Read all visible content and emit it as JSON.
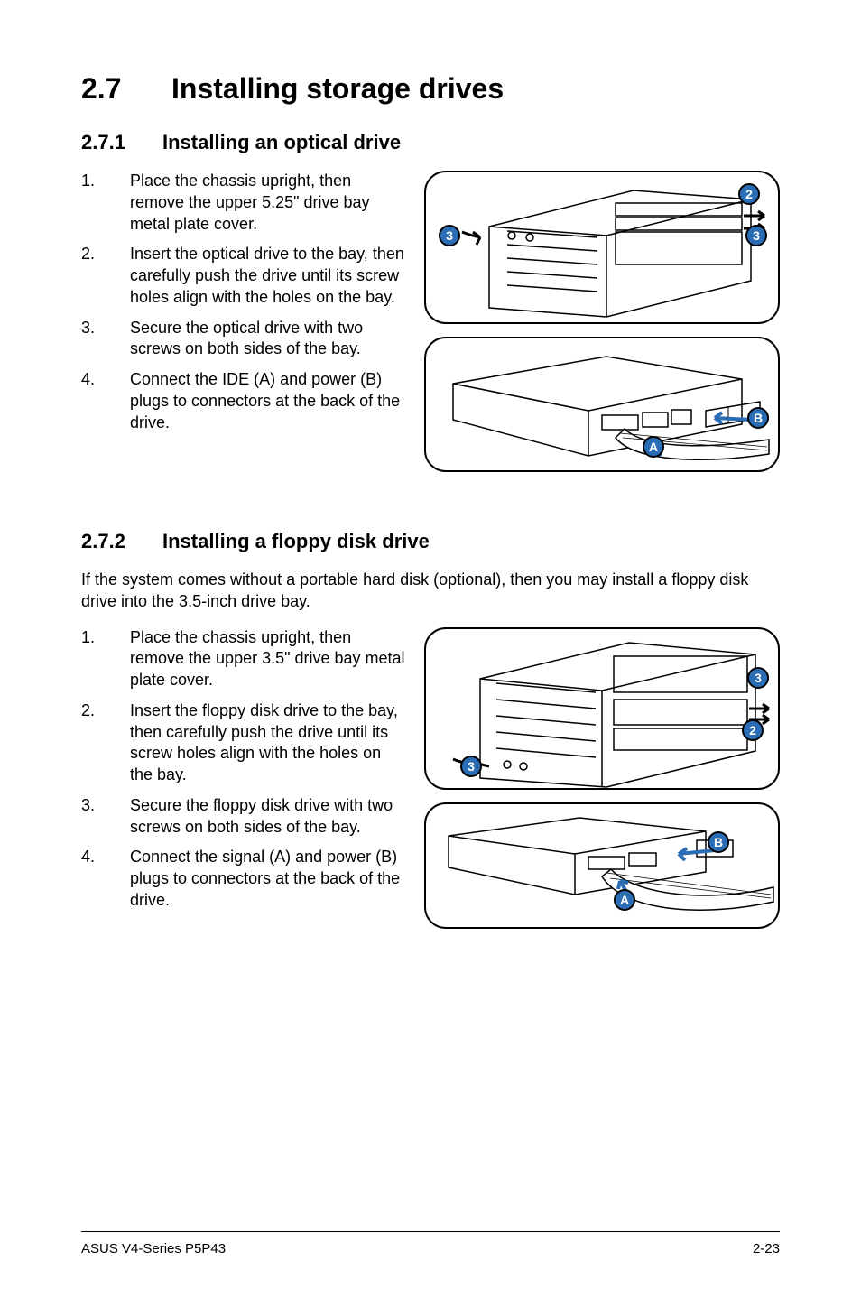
{
  "section": {
    "number": "2.7",
    "title": "Installing storage drives"
  },
  "sub1": {
    "number": "2.7.1",
    "title": "Installing an optical drive",
    "steps": [
      {
        "n": "1.",
        "t": "Place the chassis upright, then remove the upper 5.25\" drive bay metal plate cover."
      },
      {
        "n": "2.",
        "t": "Insert the optical drive to the bay, then carefully push the drive until its screw holes align with the holes on the bay."
      },
      {
        "n": "3.",
        "t": "Secure the optical drive with two screws on both sides of the bay."
      },
      {
        "n": "4.",
        "t": "Connect the IDE (A) and power (B) plugs to connectors at the back of the drive."
      }
    ],
    "fig1_callouts": {
      "c2": "2",
      "c3l": "3",
      "c3r": "3"
    },
    "fig2_callouts": {
      "a": "A",
      "b": "B"
    }
  },
  "sub2": {
    "number": "2.7.2",
    "title": "Installing a floppy disk drive",
    "intro": "If the system comes without a portable hard disk (optional), then you may install a floppy disk drive into the 3.5-inch drive bay.",
    "steps": [
      {
        "n": "1.",
        "t": "Place the chassis upright, then remove the upper 3.5\" drive bay metal plate cover."
      },
      {
        "n": "2.",
        "t": "Insert the floppy disk drive to the bay, then carefully push the drive until its screw holes align with the holes on the bay."
      },
      {
        "n": "3.",
        "t": "Secure the floppy disk drive with two screws on both sides of the bay."
      },
      {
        "n": "4.",
        "t": "Connect the signal (A) and power (B) plugs to connectors at the back of the drive."
      }
    ],
    "fig1_callouts": {
      "c2": "2",
      "c3l": "3",
      "c3r": "3"
    },
    "fig2_callouts": {
      "a": "A",
      "b": "B"
    }
  },
  "footer": {
    "left": "ASUS V4-Series P5P43",
    "right": "2-23"
  }
}
